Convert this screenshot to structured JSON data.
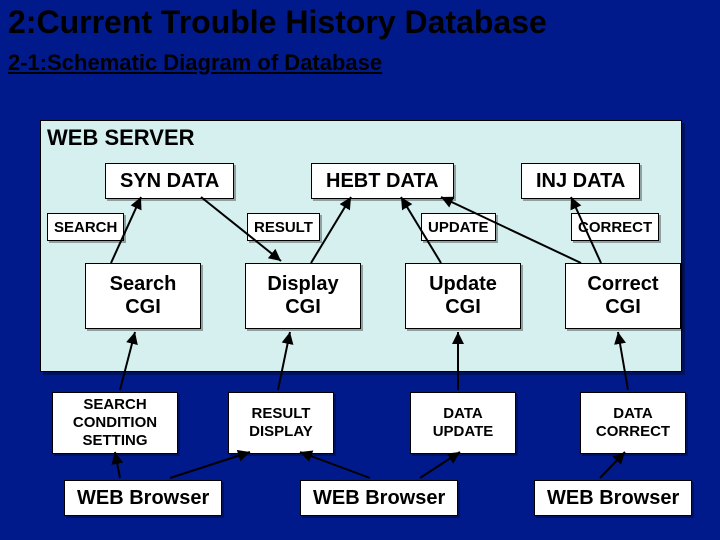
{
  "title": "2:Current Trouble History Database",
  "subtitle": "2-1:Schematic Diagram of Database",
  "server_label": "WEB SERVER",
  "db": {
    "syn": "SYN DATA",
    "hebt": "HEBT DATA",
    "inj": "INJ DATA"
  },
  "conn": {
    "search": "SEARCH",
    "result": "RESULT",
    "update": "UPDATE",
    "correct": "CORRECT"
  },
  "cgi": {
    "c1": "Search\nCGI",
    "c2": "Display\nCGI",
    "c3": "Update\nCGI",
    "c4": "Correct\nCGI"
  },
  "action": {
    "a1": "SEARCH\nCONDITION\nSETTING",
    "a2": "RESULT\nDISPLAY",
    "a3": "DATA\nUPDATE",
    "a4": "DATA\nCORRECT"
  },
  "browser": {
    "b1": "WEB Browser",
    "b2": "WEB Browser",
    "b3": "WEB Browser"
  }
}
